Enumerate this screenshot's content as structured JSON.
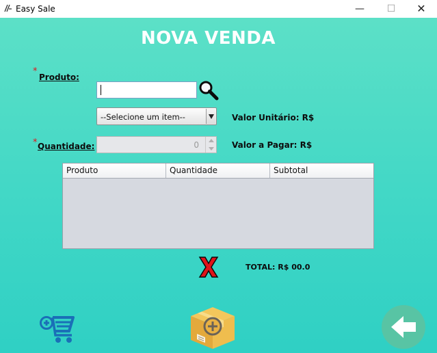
{
  "window": {
    "title": "Easy Sale",
    "controls": {
      "minimize": "—",
      "maximize": "☐",
      "close": "✕"
    }
  },
  "form": {
    "heading": "NOVA VENDA",
    "required_mark": "*",
    "product_label": "Produto:",
    "product_input_value": "",
    "product_select_value": "--Selecione um item--",
    "unit_price_label": "Valor Unitário: R$",
    "quantity_label": "Quantidade:",
    "quantity_value": "0",
    "amount_due_label": "Valor a Pagar: R$"
  },
  "table": {
    "columns": [
      "Produto",
      "Quantidade",
      "Subtotal"
    ],
    "rows": []
  },
  "summary": {
    "total_label": "TOTAL: R$ 00.0"
  },
  "icons": {
    "search": "magnifier-icon",
    "cancel": "red-x-icon",
    "cart": "add-to-cart-icon",
    "box": "add-box-icon",
    "back": "back-arrow-icon"
  },
  "colors": {
    "background_top": "#5ce0c7",
    "background_bottom": "#2fd0c4",
    "heading": "#ffffff",
    "required": "#e0141a",
    "cart": "#1a6fb7",
    "back_button": "#58c4a4",
    "cancel": "#e0141a"
  }
}
